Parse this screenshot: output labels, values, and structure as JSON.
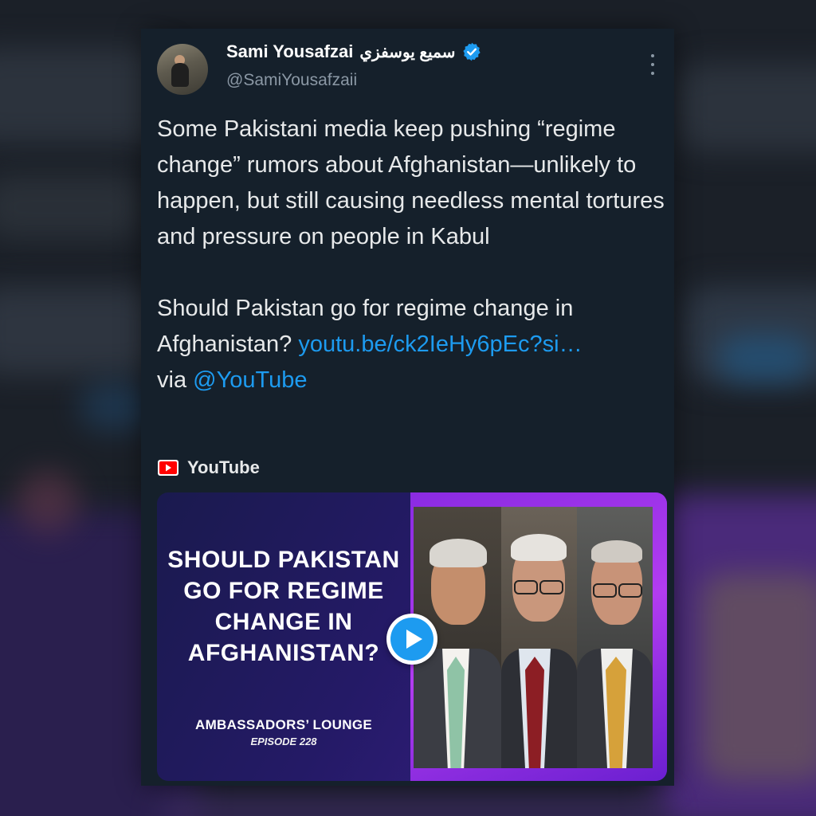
{
  "author": {
    "display_name": "Sami Yousafzai",
    "urdu_name": "سمیع یوسفزي",
    "handle": "@SamiYousafzaii",
    "verified_icon": "verified-badge-icon",
    "avatar_icon": "user-avatar-photo"
  },
  "tweet": {
    "para1": "Some Pakistani media keep pushing “regime change” rumors about Afghanistan—unlikely to happen, but still causing needless mental  tortures and pressure on people in Kabul",
    "para2_text": "Should Pakistan go for regime change in Afghanistan? ",
    "link": "youtu.be/ck2IeHy6pEc?si…",
    "via": "via ",
    "mention": "@YouTube"
  },
  "card": {
    "source_icon": "youtube-logo-icon",
    "source_label": "YouTube",
    "thumbnail_title": "SHOULD PAKISTAN GO FOR REGIME CHANGE IN AFGHANISTAN?",
    "thumbnail_series": "AMBASSADORS’ LOUNGE",
    "thumbnail_episode": "EPISODE 228",
    "play_icon": "play-icon"
  },
  "colors": {
    "background": "#15202b",
    "text": "#e7e9ea",
    "secondary_text": "#8b98a5",
    "link": "#1d9bf0",
    "youtube_red": "#ff0000",
    "thumbnail_accent": "#8a2be2"
  }
}
